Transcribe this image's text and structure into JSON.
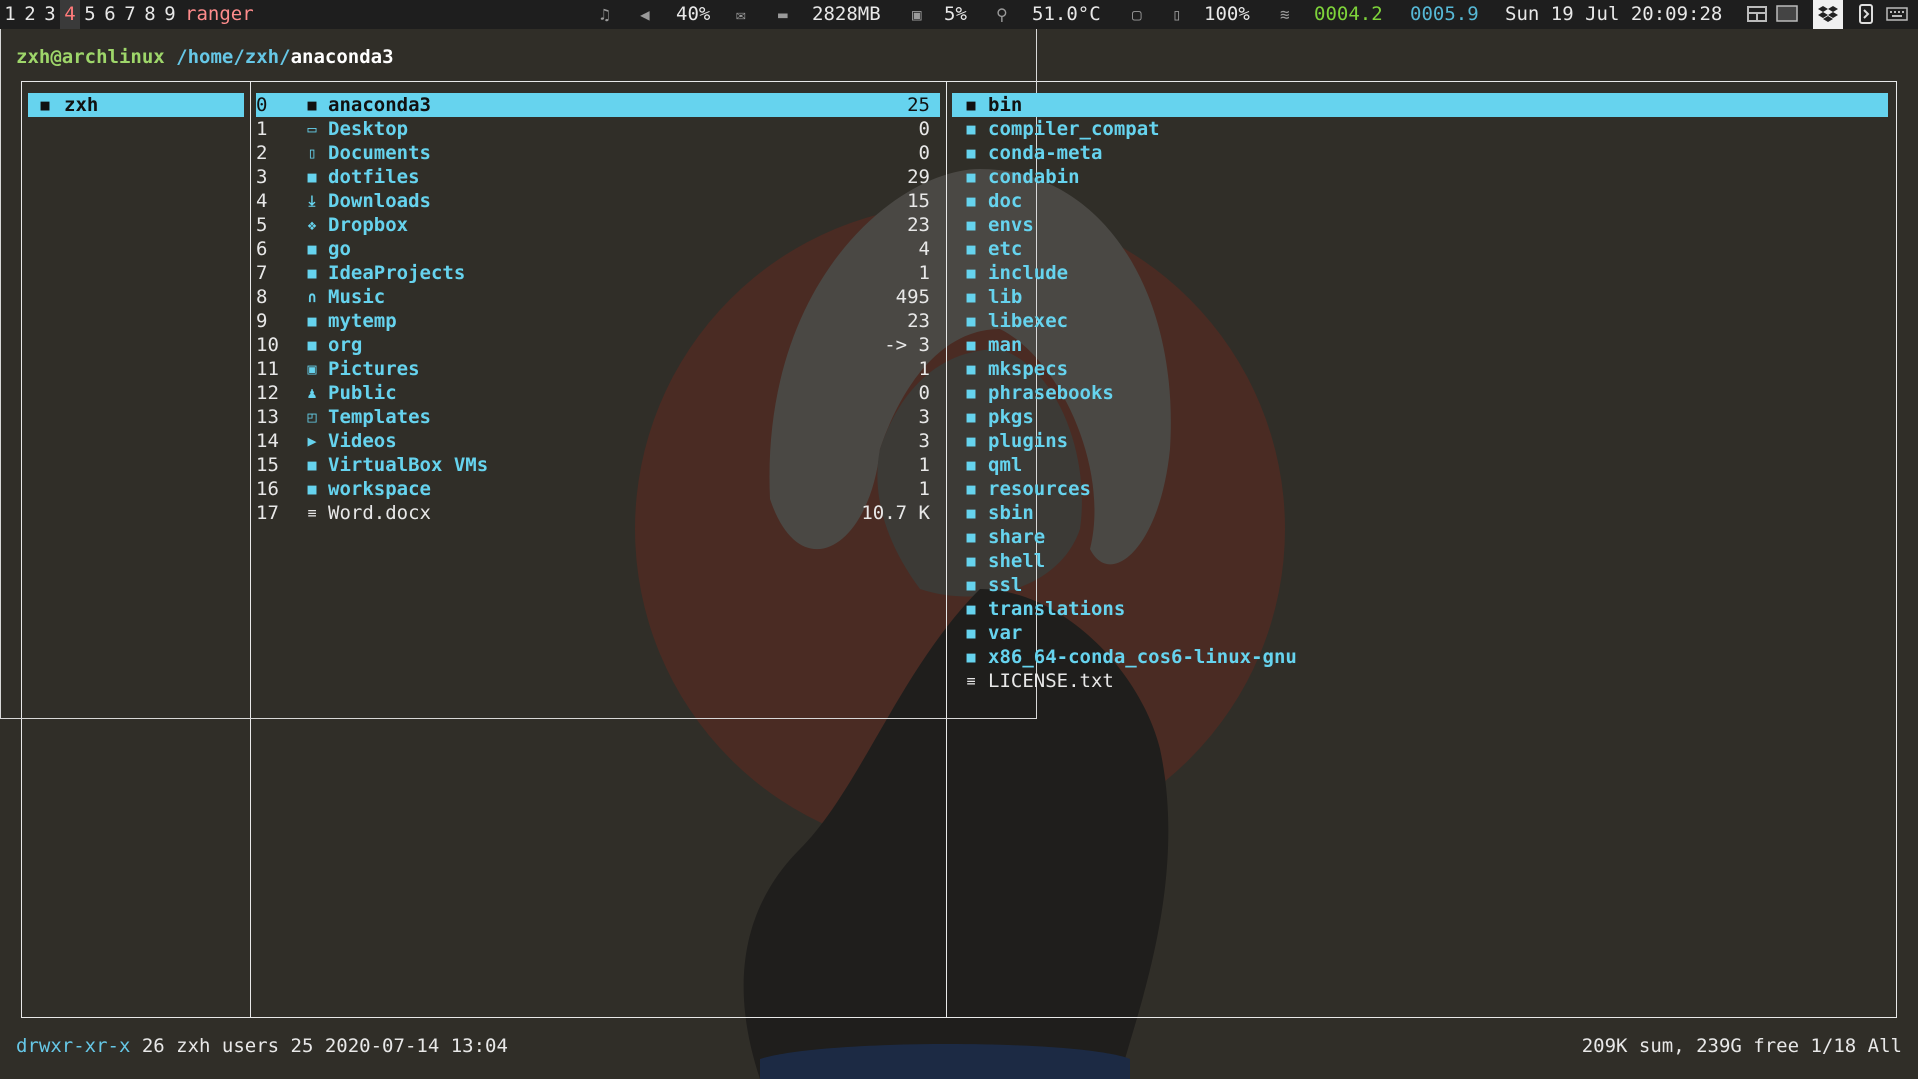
{
  "topbar": {
    "workspaces": [
      "1",
      "2",
      "3",
      "4",
      "5",
      "6",
      "7",
      "8",
      "9"
    ],
    "active_workspace": "4",
    "window_title": "ranger",
    "music_icon": "music-note-icon",
    "volume": "40%",
    "memory": "2828MB",
    "cpu": "5%",
    "temperature": "51.0°C",
    "battery": "100%",
    "net_down": "0004.2",
    "net_up": "0005.9",
    "datetime": "Sun 19 Jul 20:09:28"
  },
  "terminal": {
    "user_host": "zxh@archlinux",
    "path_dir": "/home/zxh/",
    "path_base": "anaconda3"
  },
  "parent_column": {
    "items": [
      {
        "name": "zxh",
        "icon": "folder-icon"
      }
    ]
  },
  "main_column": {
    "items": [
      {
        "num": "0",
        "name": "anaconda3",
        "count": "25",
        "icon": "folder-icon"
      },
      {
        "num": "1",
        "name": "Desktop",
        "count": "0",
        "icon": "desktop-icon"
      },
      {
        "num": "2",
        "name": "Documents",
        "count": "0",
        "icon": "document-icon"
      },
      {
        "num": "3",
        "name": "dotfiles",
        "count": "29",
        "icon": "folder-icon"
      },
      {
        "num": "4",
        "name": "Downloads",
        "count": "15",
        "icon": "download-icon"
      },
      {
        "num": "5",
        "name": "Dropbox",
        "count": "23",
        "icon": "dropbox-icon"
      },
      {
        "num": "6",
        "name": "go",
        "count": "4",
        "icon": "folder-icon"
      },
      {
        "num": "7",
        "name": "IdeaProjects",
        "count": "1",
        "icon": "folder-icon"
      },
      {
        "num": "8",
        "name": "Music",
        "count": "495",
        "icon": "headphones-icon"
      },
      {
        "num": "9",
        "name": "mytemp",
        "count": "23",
        "icon": "folder-icon"
      },
      {
        "num": "10",
        "name": "org",
        "count": "-> 3",
        "icon": "folder-link-icon"
      },
      {
        "num": "11",
        "name": "Pictures",
        "count": "1",
        "icon": "picture-icon"
      },
      {
        "num": "12",
        "name": "Public",
        "count": "0",
        "icon": "users-icon"
      },
      {
        "num": "13",
        "name": "Templates",
        "count": "3",
        "icon": "template-icon"
      },
      {
        "num": "14",
        "name": "Videos",
        "count": "3",
        "icon": "video-icon"
      },
      {
        "num": "15",
        "name": "VirtualBox VMs",
        "count": "1",
        "icon": "folder-icon"
      },
      {
        "num": "16",
        "name": "workspace",
        "count": "1",
        "icon": "folder-icon"
      },
      {
        "num": "17",
        "name": "Word.docx",
        "count": "10.7 K",
        "icon": "file-icon",
        "file": true
      }
    ]
  },
  "preview_column": {
    "items": [
      {
        "name": "bin",
        "icon": "folder-icon"
      },
      {
        "name": "compiler_compat",
        "icon": "folder-icon"
      },
      {
        "name": "conda-meta",
        "icon": "folder-icon"
      },
      {
        "name": "condabin",
        "icon": "folder-icon"
      },
      {
        "name": "doc",
        "icon": "folder-icon"
      },
      {
        "name": "envs",
        "icon": "folder-icon"
      },
      {
        "name": "etc",
        "icon": "folder-icon"
      },
      {
        "name": "include",
        "icon": "folder-icon"
      },
      {
        "name": "lib",
        "icon": "folder-icon"
      },
      {
        "name": "libexec",
        "icon": "folder-icon"
      },
      {
        "name": "man",
        "icon": "folder-icon"
      },
      {
        "name": "mkspecs",
        "icon": "folder-icon"
      },
      {
        "name": "phrasebooks",
        "icon": "folder-icon"
      },
      {
        "name": "pkgs",
        "icon": "folder-icon"
      },
      {
        "name": "plugins",
        "icon": "folder-icon"
      },
      {
        "name": "qml",
        "icon": "folder-icon"
      },
      {
        "name": "resources",
        "icon": "folder-icon"
      },
      {
        "name": "sbin",
        "icon": "folder-icon"
      },
      {
        "name": "share",
        "icon": "folder-icon"
      },
      {
        "name": "shell",
        "icon": "folder-icon"
      },
      {
        "name": "ssl",
        "icon": "folder-icon"
      },
      {
        "name": "translations",
        "icon": "folder-icon"
      },
      {
        "name": "var",
        "icon": "folder-icon"
      },
      {
        "name": "x86_64-conda_cos6-linux-gnu",
        "icon": "folder-icon"
      },
      {
        "name": "LICENSE.txt",
        "icon": "file-icon",
        "file": true
      }
    ]
  },
  "statusline": {
    "permissions": "drwxr-xr-x",
    "details": "26 zxh users 25 2020-07-14 13:04",
    "summary": "209K sum, 239G free  1/18  All"
  },
  "colors": {
    "accent": "#66d3ee",
    "user_green": "#9ed66a",
    "background": "#302e28"
  }
}
